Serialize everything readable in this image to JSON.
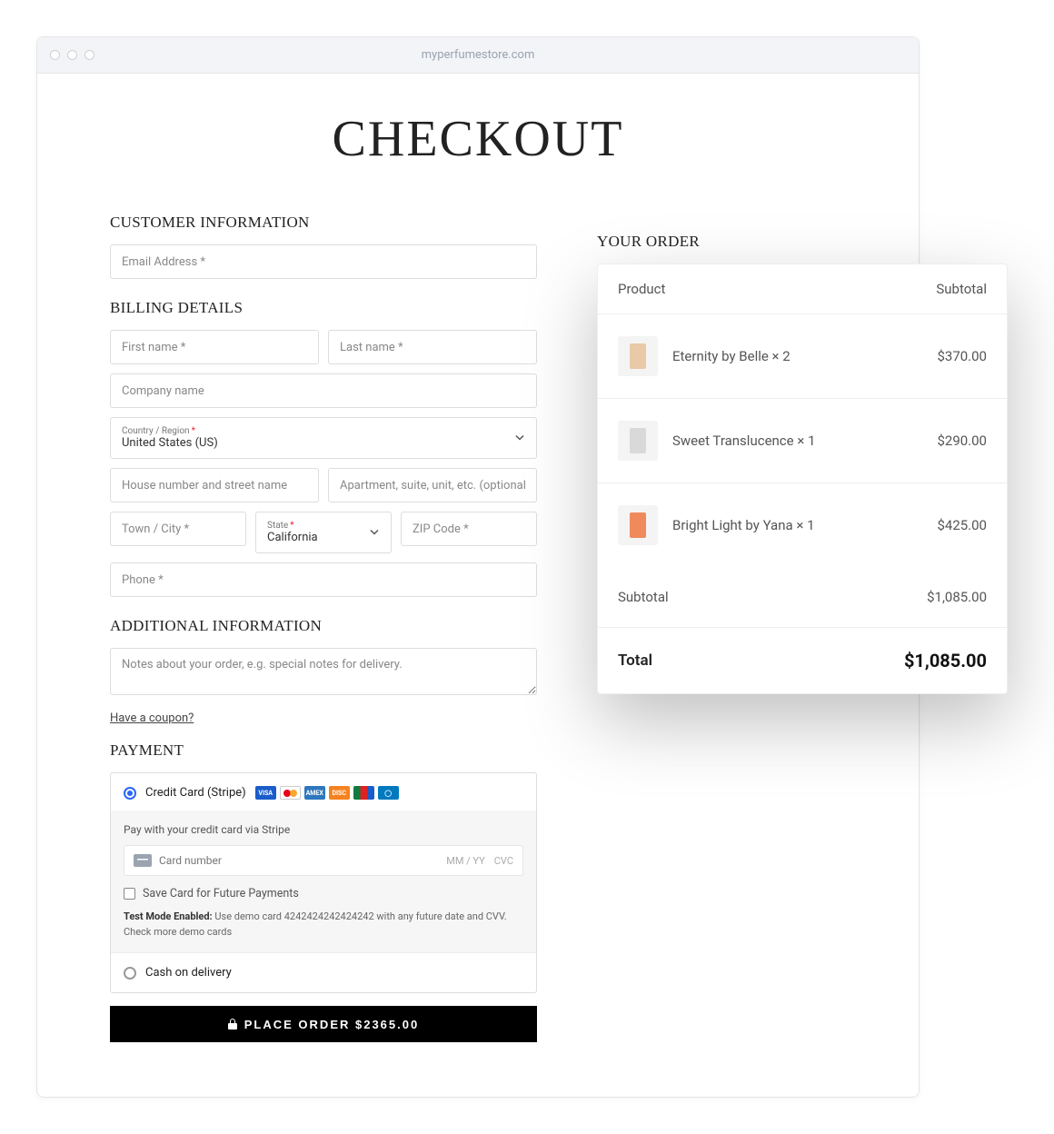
{
  "address_bar": "myperfumestore.com",
  "page_title": "CHECKOUT",
  "sections": {
    "customer_info": "CUSTOMER INFORMATION",
    "billing": "BILLING DETAILS",
    "additional": "ADDITIONAL INFORMATION",
    "payment": "PAYMENT",
    "order": "YOUR ORDER"
  },
  "placeholders": {
    "email": "Email Address *",
    "first_name": "First name *",
    "last_name": "Last name *",
    "company": "Company name",
    "street": "House number and street name",
    "apt": "Apartment, suite, unit, etc. (optional)",
    "city": "Town / City *",
    "zip": "ZIP Code *",
    "phone": "Phone *",
    "notes": "Notes about your order, e.g. special notes for delivery.",
    "card_number": "Card number",
    "mmyy": "MM / YY",
    "cvc": "CVC"
  },
  "labels": {
    "country": "Country / Region",
    "state": "State",
    "coupon": "Have a coupon?",
    "credit_card": "Credit Card (Stripe)",
    "pay_via_stripe": "Pay with your credit card via Stripe",
    "save_card": "Save Card for Future Payments",
    "test_bold": "Test Mode Enabled:",
    "test_rest": " Use demo card 4242424242424242 with any future date and CVV. Check more demo cards",
    "cod": "Cash on delivery",
    "place_order": "PLACE ORDER $2365.00"
  },
  "selects": {
    "country_value": "United States (US)",
    "state_value": "California"
  },
  "order": {
    "header_product": "Product",
    "header_subtotal": "Subtotal",
    "items": [
      {
        "name": "Eternity by Belle × 2",
        "price": "$370.00",
        "color": "#e8c9a8"
      },
      {
        "name": "Sweet Translucence × 1",
        "price": "$290.00",
        "color": "#d9d9d9"
      },
      {
        "name": "Bright Light by Yana × 1",
        "price": "$425.00",
        "color": "#f08a5d"
      }
    ],
    "subtotal_label": "Subtotal",
    "subtotal_value": "$1,085.00",
    "total_label": "Total",
    "total_value": "$1,085.00"
  }
}
